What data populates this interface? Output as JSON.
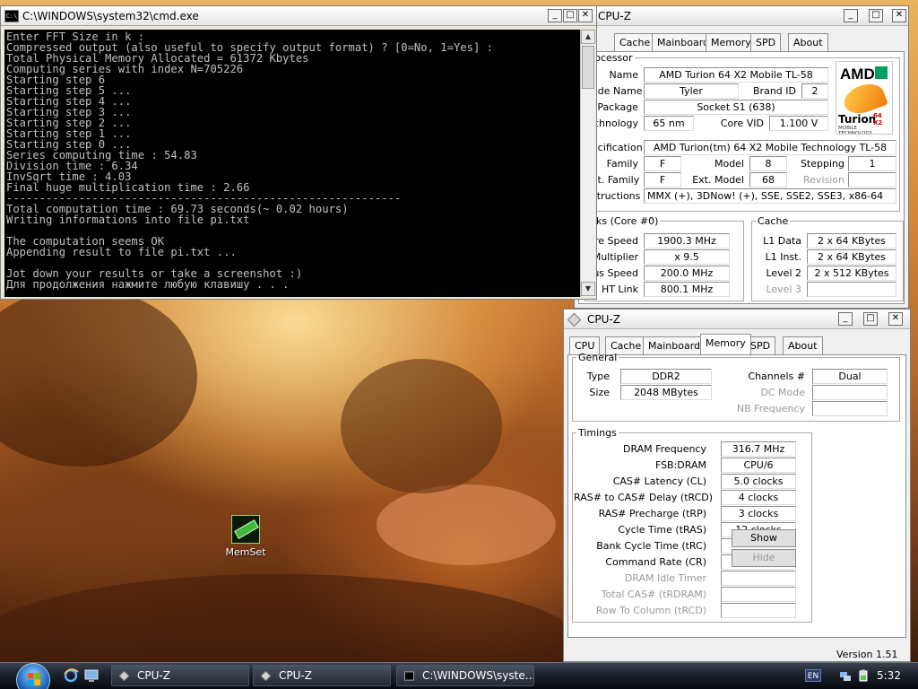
{
  "cmd": {
    "title": "C:\\WINDOWS\\system32\\cmd.exe",
    "icon": "cmd-icon",
    "lines": [
      "Enter FFT Size in k :",
      "Compressed output (also useful to specify output format) ? [0=No, 1=Yes] :",
      "Total Physical Memory Allocated = 61372 Kbytes",
      "Computing series with index N=705226",
      "Starting step 6",
      "Starting step 5 ...",
      "Starting step 4 ...",
      "Starting step 3 ...",
      "Starting step 2 ...",
      "Starting step 1 ...",
      "Starting step 0 ...",
      "Series computing time : 54.83",
      "Division time : 6.34",
      "InvSqrt time : 4.03",
      "Final huge multiplication time : 2.66",
      "------------------------------------------------------------",
      "Total computation time : 69.73 seconds(~ 0.02 hours)",
      "Writing informations into file pi.txt",
      "",
      "The computation seems OK",
      "Appending result to file pi.txt ...",
      "",
      "Jot down your results or take a screenshot :)",
      "Для продолжения нажмите любую клавишу . . ."
    ]
  },
  "cpuz_back": {
    "title": "CPU-Z",
    "tabs": [
      "Cache",
      "Mainboard",
      "Memory",
      "SPD",
      "About"
    ],
    "processor_legend": "rocessor",
    "logo": {
      "brand": "AMD",
      "product": "Turion",
      "sub": "64 X2",
      "tagline": "MOBILE TECHNOLOGY"
    },
    "name_label": "Name",
    "name": "AMD Turion 64 X2 Mobile TL-58",
    "codename_label": "ode Name",
    "codename": "Tyler",
    "brandid_label": "Brand ID",
    "brandid": "2",
    "package_label": "Package",
    "package": "Socket S1 (638)",
    "tech_label": "chnology",
    "tech": "65 nm",
    "corevid_label": "Core VID",
    "corevid": "1.100 V",
    "spec_label": "ecification",
    "spec": "AMD Turion(tm) 64 X2 Mobile Technology TL-58",
    "family_label": "Family",
    "family": "F",
    "model_label": "Model",
    "model": "8",
    "stepping_label": "Stepping",
    "stepping": "1",
    "extfamily_label": "xt. Family",
    "extfamily": "F",
    "extmodel_label": "Ext. Model",
    "extmodel": "68",
    "revision_label": "Revision",
    "revision": "",
    "instr_label": "structions",
    "instr": "MMX (+), 3DNow! (+), SSE, SSE2, SSE3, x86-64",
    "clocks_legend": "cks (Core #0)",
    "corespeed_label": "re Speed",
    "corespeed": "1900.3 MHz",
    "multiplier_label": "Multiplier",
    "multiplier": "x 9.5",
    "busspeed_label": "us Speed",
    "busspeed": "200.0 MHz",
    "htlink_label": "HT Link",
    "htlink": "800.1 MHz",
    "cache_legend": "Cache",
    "l1data_label": "L1 Data",
    "l1data": "2 x 64 KBytes",
    "l1inst_label": "L1 Inst.",
    "l1inst": "2 x 64 KBytes",
    "level2_label": "Level 2",
    "level2": "2 x 512 KBytes",
    "level3_label": "Level 3",
    "level3": ""
  },
  "cpuz_front": {
    "title": "CPU-Z",
    "tabs": [
      "CPU",
      "Cache",
      "Mainboard",
      "Memory",
      "SPD",
      "About"
    ],
    "active_tab": "Memory",
    "general_legend": "General",
    "type_label": "Type",
    "type": "DDR2",
    "size_label": "Size",
    "size": "2048 MBytes",
    "channels_label": "Channels #",
    "channels": "Dual",
    "dcmode_label": "DC Mode",
    "dcmode": "",
    "nbfreq_label": "NB Frequency",
    "nbfreq": "",
    "timings_legend": "Timings",
    "dramfreq_label": "DRAM Frequency",
    "dramfreq": "316.7 MHz",
    "fsbdram_label": "FSB:DRAM",
    "fsbdram": "CPU/6",
    "cas_label": "CAS# Latency (CL)",
    "cas": "5.0 clocks",
    "trcd_label": "RAS# to CAS# Delay (tRCD)",
    "trcd": "4 clocks",
    "trp_label": "RAS# Precharge (tRP)",
    "trp": "3 clocks",
    "tras_label": "Cycle Time (tRAS)",
    "tras": "12 clocks",
    "trc_label": "Bank Cycle Time (tRC)",
    "trc": "",
    "cr_label": "Command Rate (CR)",
    "cr": "",
    "idle_label": "DRAM Idle Timer",
    "idle": "",
    "trdram_label": "Total CAS# (tRDRAM)",
    "trdram": "",
    "trcdcol_label": "Row To Column (tRCD)",
    "trcdcol": "",
    "show_label": "Show",
    "hide_label": "Hide",
    "version": "Version 1.51"
  },
  "desktop": {
    "icon_label": "MemSet"
  },
  "taskbar": {
    "items": [
      "CPU-Z",
      "CPU-Z",
      "C:\\WINDOWS\\syste..."
    ],
    "lang": "EN",
    "clock": "5:32"
  }
}
